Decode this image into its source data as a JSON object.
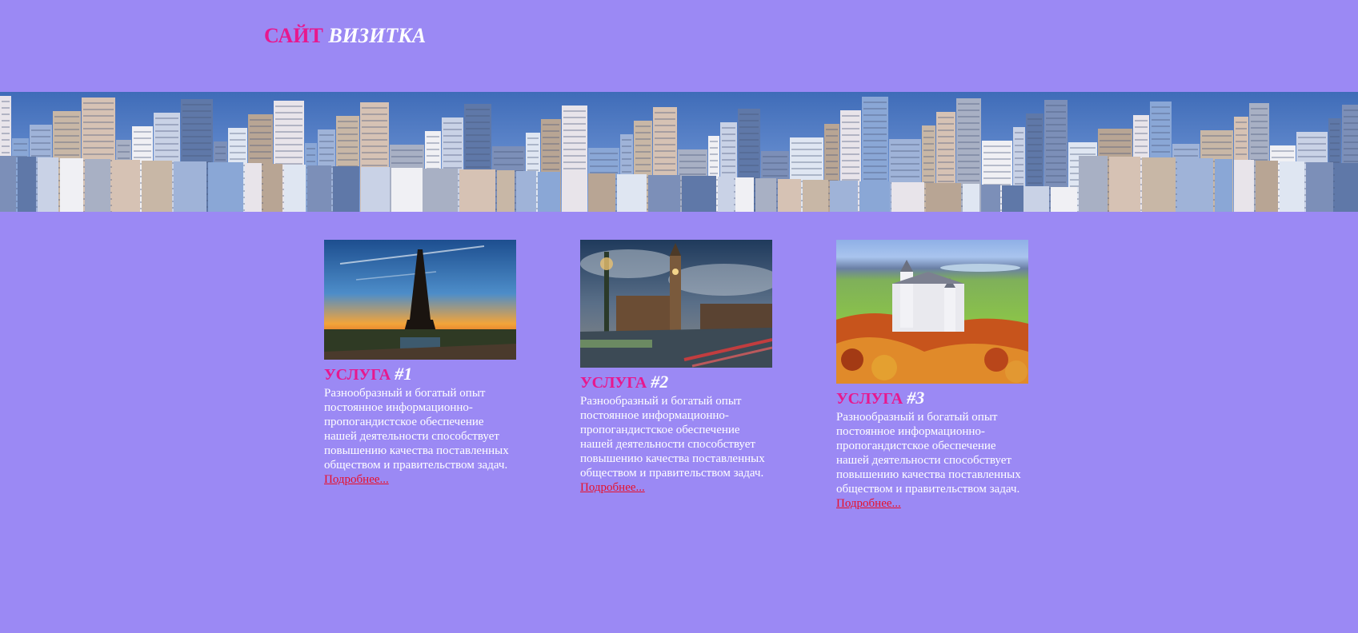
{
  "logo": {
    "part1": "САЙТ",
    "part2": "ВИЗИТКА"
  },
  "banner": {
    "image": "city-skyline-image"
  },
  "services": [
    {
      "title_word": "УСЛУГА",
      "title_num": "#1",
      "text": "Разнообразный и богатый опыт постоянное информационно-пропогандистское обеспечение нашей деятельности способствует повышению качества поставленных обществом и правительством задач.",
      "link": "Подробнее..."
    },
    {
      "title_word": "УСЛУГА",
      "title_num": "#2",
      "text": "Разнообразный и богатый опыт постоянное информационно-пропогандистское обеспечение нашей деятельности способствует повышению качества поставленных обществом и правительством задач.",
      "link": "Подробнее..."
    },
    {
      "title_word": "УСЛУГА",
      "title_num": "#3",
      "text": "Разнообразный и богатый опыт постоянное информационно-пропогандистское обеспечение нашей деятельности способствует повышению качества поставленных обществом и правительством задач.",
      "link": "Подробнее..."
    }
  ],
  "colors": {
    "background": "#9b89f4",
    "accent_pink": "#e7188e",
    "link_red": "#e8102a",
    "text": "#ffffff"
  }
}
